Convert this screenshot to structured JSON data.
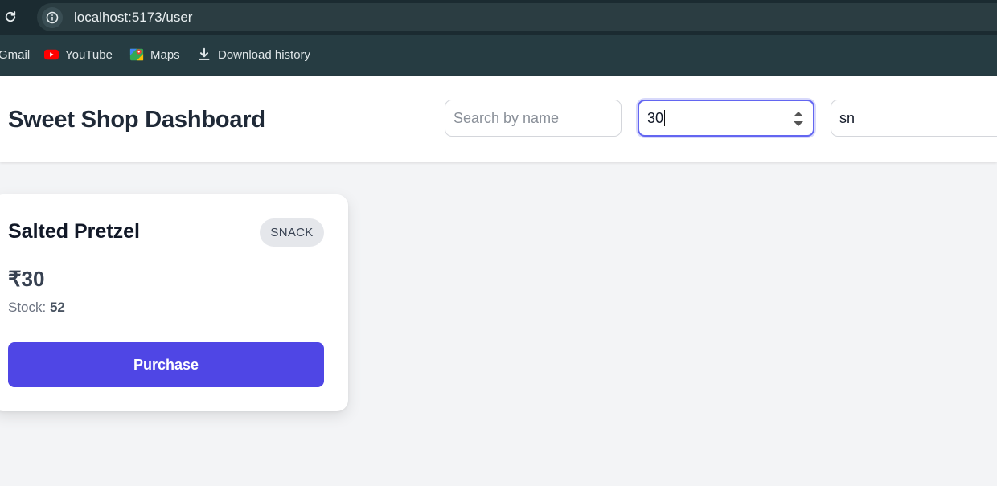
{
  "browser": {
    "url": "localhost:5173/user",
    "bookmarks": [
      {
        "label": "Gmail",
        "icon": "gmail-icon"
      },
      {
        "label": "YouTube",
        "icon": "youtube-icon"
      },
      {
        "label": "Maps",
        "icon": "maps-icon"
      },
      {
        "label": "Download history",
        "icon": "download-icon"
      }
    ]
  },
  "header": {
    "title": "Sweet Shop Dashboard",
    "search": {
      "placeholder": "Search by name",
      "value": ""
    },
    "price_filter": {
      "value": "30"
    },
    "category_filter": {
      "value": "sn"
    }
  },
  "products": [
    {
      "name": "Salted Pretzel",
      "category": "SNACK",
      "price": "₹30",
      "stock_label": "Stock:",
      "stock_value": "52",
      "button": "Purchase"
    }
  ],
  "colors": {
    "accent": "#4f46e5",
    "focus_ring": "#6366f1",
    "page_bg": "#f3f4f6",
    "chrome_dark": "#1b2b31"
  }
}
